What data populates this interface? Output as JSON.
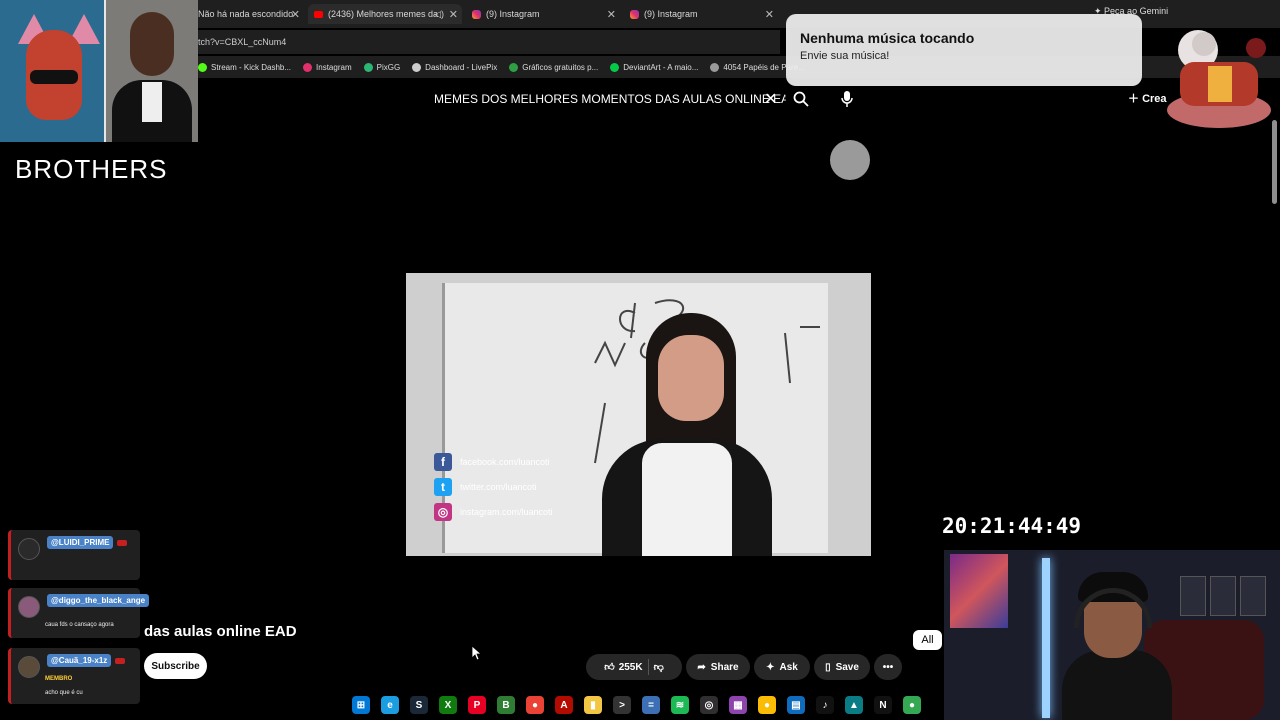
{
  "browser": {
    "tabs": [
      {
        "title": "Não há nada escondido",
        "type": "plain"
      },
      {
        "title": "(2436) Melhores memes da",
        "type": "youtube",
        "active": true
      },
      {
        "title": "(9) Instagram",
        "type": "instagram"
      },
      {
        "title": "(9) Instagram",
        "type": "instagram"
      }
    ],
    "url_fragment": "tch?v=CBXL_ccNum4",
    "gemini_label": "Peça ao Gemini",
    "bookmarks": [
      {
        "label": "Stream - Kick Dashb...",
        "color": "#53fc18"
      },
      {
        "label": "Instagram",
        "color": "#e1306c"
      },
      {
        "label": "PixGG",
        "color": "#2bb673"
      },
      {
        "label": "Dashboard - LivePix",
        "color": "#cccccc"
      },
      {
        "label": "Gráficos gratuitos p...",
        "color": "#2ea043"
      },
      {
        "label": "DeviantArt - A maio...",
        "color": "#05cc47"
      },
      {
        "label": "4054 Papéis de Pare...",
        "color": "#999999"
      }
    ]
  },
  "overlay": {
    "brothers_label": "BROTHERS",
    "music_title": "Nenhuma música tocando",
    "music_subtitle": "Envie sua música!",
    "clock": "20:21:44:49"
  },
  "youtube": {
    "search_query": "MEMES DOS MELHORES MOMENTOS DAS AULAS ONLINE EAD",
    "create_label": "Crea",
    "video_title_fragment": "das aulas online EAD",
    "subscribe_label": "Subscribe",
    "likes": "255K",
    "share_label": "Share",
    "ask_label": "Ask",
    "save_label": "Save",
    "chip_all": "All",
    "watermark_links": [
      {
        "text": "facebook.com/luancoti",
        "color": "#3b5998",
        "glyph": "f"
      },
      {
        "text": "twitter.com/luancoti",
        "color": "#1da1f2",
        "glyph": "t"
      },
      {
        "text": "instagram.com/luancoti",
        "color": "#c13584",
        "glyph": "◎"
      }
    ]
  },
  "chat": [
    {
      "user": "@LUIDI_PRIME",
      "badge": "",
      "message": ""
    },
    {
      "user": "@diggo_the_black_ange",
      "badge": "",
      "message": "caua fds o cansaço agora"
    },
    {
      "user": "@Cauã_19-x1z",
      "badge": "MEMBRO",
      "message": "acho que é cu"
    }
  ],
  "taskbar": [
    {
      "name": "windows-start-icon",
      "color": "#0078d4",
      "glyph": "⊞"
    },
    {
      "name": "edge-icon",
      "color": "#1b9de2",
      "glyph": "e"
    },
    {
      "name": "steam-icon",
      "color": "#1b2838",
      "glyph": "S"
    },
    {
      "name": "xbox-icon",
      "color": "#107c10",
      "glyph": "X"
    },
    {
      "name": "pinterest-icon",
      "color": "#e60023",
      "glyph": "P"
    },
    {
      "name": "app-b-icon",
      "color": "#2e7d32",
      "glyph": "B"
    },
    {
      "name": "chrome-icon",
      "color": "#ea4335",
      "glyph": "●"
    },
    {
      "name": "acrobat-icon",
      "color": "#b30b00",
      "glyph": "A"
    },
    {
      "name": "folder-icon",
      "color": "#f2c744",
      "glyph": "▮"
    },
    {
      "name": "terminal-icon",
      "color": "#333333",
      "glyph": ">"
    },
    {
      "name": "calculator-icon",
      "color": "#3d6fb5",
      "glyph": "="
    },
    {
      "name": "spotify-icon",
      "color": "#1db954",
      "glyph": "≋"
    },
    {
      "name": "obs-icon",
      "color": "#302e31",
      "glyph": "◎"
    },
    {
      "name": "app-gallery-icon",
      "color": "#8e44ad",
      "glyph": "▦"
    },
    {
      "name": "chrome-alt-icon",
      "color": "#fbbc05",
      "glyph": "●"
    },
    {
      "name": "calendar-icon",
      "color": "#0f6cbd",
      "glyph": "▤"
    },
    {
      "name": "tiktok-icon",
      "color": "#111111",
      "glyph": "♪"
    },
    {
      "name": "photo-editor-icon",
      "color": "#0a7c86",
      "glyph": "▲"
    },
    {
      "name": "netflix-icon",
      "color": "#111111",
      "glyph": "N"
    },
    {
      "name": "chrome-third-icon",
      "color": "#34a853",
      "glyph": "●"
    }
  ]
}
